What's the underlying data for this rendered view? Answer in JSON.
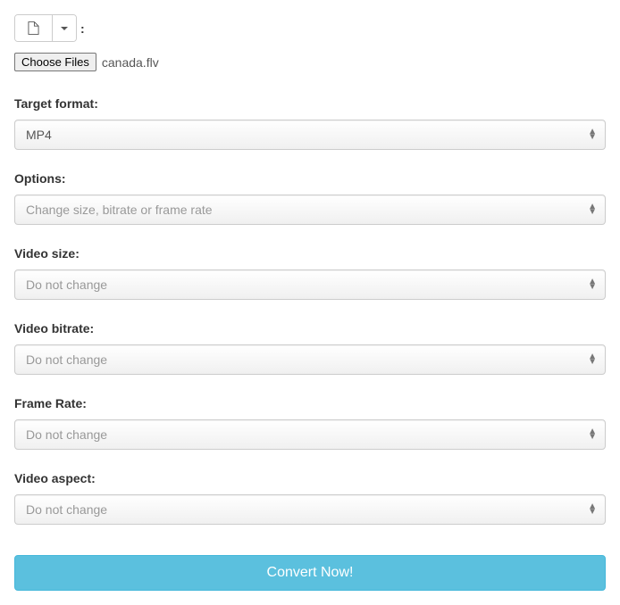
{
  "topRow": {
    "colon": ":"
  },
  "fileRow": {
    "chooseFilesLabel": "Choose Files",
    "fileName": "canada.flv"
  },
  "fields": {
    "targetFormat": {
      "label": "Target format:",
      "value": "MP4"
    },
    "options": {
      "label": "Options:",
      "value": "Change size, bitrate or frame rate"
    },
    "videoSize": {
      "label": "Video size:",
      "value": "Do not change"
    },
    "videoBitrate": {
      "label": "Video bitrate:",
      "value": "Do not change"
    },
    "frameRate": {
      "label": "Frame Rate:",
      "value": "Do not change"
    },
    "videoAspect": {
      "label": "Video aspect:",
      "value": "Do not change"
    }
  },
  "convertButton": "Convert Now!"
}
